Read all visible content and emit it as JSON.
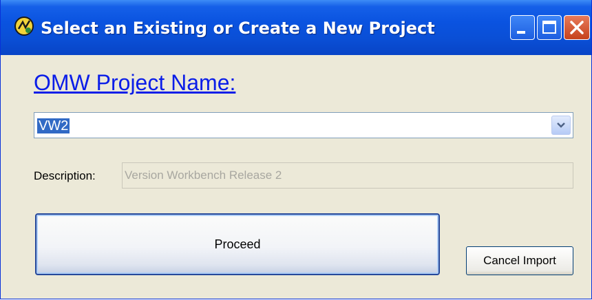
{
  "window": {
    "title": "Select an Existing or Create a New Project",
    "controls": {
      "minimize": "minimize",
      "maximize": "maximize",
      "close": "close"
    }
  },
  "form": {
    "heading": "OMW Project Name:",
    "project": {
      "value": "VW2",
      "icon": "chevron-down-icon"
    },
    "description": {
      "label": "Description:",
      "value": "Version Workbench Release 2"
    },
    "proceed_label": "Proceed",
    "cancel_label": "Cancel Import"
  },
  "colors": {
    "titlebar": "#0a53e0",
    "heading": "#0a1de8",
    "selection": "#316ac5",
    "close_button": "#d4502a"
  }
}
